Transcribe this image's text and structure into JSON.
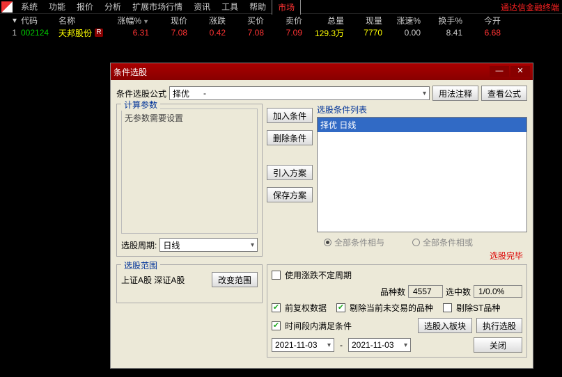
{
  "brand": "通达信金融终端",
  "menu": [
    "系统",
    "功能",
    "报价",
    "分析",
    "扩展市场行情",
    "资讯",
    "工具",
    "帮助",
    "市场"
  ],
  "menu_active_index": 8,
  "columns": [
    "代码",
    "名称",
    "涨幅%",
    "现价",
    "涨跌",
    "买价",
    "卖价",
    "总量",
    "现量",
    "涨速%",
    "换手%",
    "今开"
  ],
  "row": {
    "idx": "1",
    "code": "002124",
    "name": "天邦股份",
    "badge": "R",
    "pct": "6.31",
    "price": "7.08",
    "chg": "0.42",
    "bid": "7.08",
    "ask": "7.09",
    "vol": "129.3万",
    "cur": "7770",
    "speed": "0.00",
    "turn": "8.41",
    "open": "6.68"
  },
  "dialog": {
    "title": "条件选股",
    "formula_label": "条件选股公式",
    "formula_value": "择优",
    "formula_sep": "-",
    "btn_usage": "用法注释",
    "btn_view": "查看公式",
    "calc_legend": "计算参数",
    "calc_text": "无参数需要设置",
    "period_label": "选股周期:",
    "period_value": "日线",
    "btn_add": "加入条件",
    "btn_del": "删除条件",
    "btn_import": "引入方案",
    "btn_save": "保存方案",
    "list_legend": "选股条件列表",
    "list_item": "择优   日线",
    "radio_and": "全部条件相与",
    "radio_or": "全部条件相或",
    "status": "选股完毕",
    "scope_legend": "选股范围",
    "scope_text": "上证A股  深证A股",
    "btn_scope": "改变范围",
    "ck_irregular": "使用涨跌不定周期",
    "stat_count_lbl": "品种数",
    "stat_count": "4557",
    "stat_hit_lbl": "选中数",
    "stat_hit": "1/0.0%",
    "ck_fq": "前复权数据",
    "ck_ex_nontrade": "剔除当前未交易的品种",
    "ck_ex_st": "剔除ST品种",
    "ck_time": "时间段内满足条件",
    "btn_to_block": "选股入板块",
    "btn_run": "执行选股",
    "date_from": "2021-11-03",
    "date_to": "2021-11-03",
    "date_sep": "-",
    "btn_close": "关闭"
  }
}
